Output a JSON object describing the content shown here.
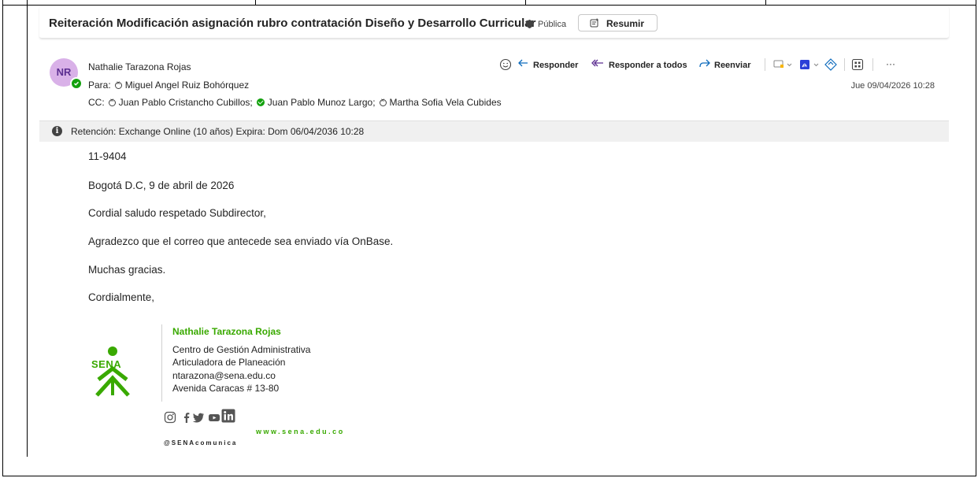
{
  "subject": {
    "title": "Reiteración Modificación asignación rubro contratación Diseño y Desarrollo Curricular",
    "sensitivity_label": "Pública",
    "summarize_label": "Resumir"
  },
  "message": {
    "avatar_initials": "NR",
    "sender": "Nathalie Tarazona Rojas",
    "to_label": "Para:",
    "to": [
      "Miguel Angel Ruiz Bohórquez"
    ],
    "cc_label": "CC:",
    "cc": [
      {
        "name": "Juan Pablo Cristancho Cubillos;",
        "status": "unknown"
      },
      {
        "name": "Juan Pablo Munoz Largo;",
        "status": "available"
      },
      {
        "name": "Martha Sofia Vela Cubides",
        "status": "unknown"
      }
    ],
    "date": "Jue 09/04/2026 10:28"
  },
  "toolbar": {
    "reply": "Responder",
    "reply_all": "Responder a todos",
    "forward": "Reenviar",
    "more": "···"
  },
  "retention": {
    "text": "Retención: Exchange Online (10 años) Expira: Dom 06/04/2036 10:28"
  },
  "body": {
    "lines": [
      "11-9404",
      "Bogotá D.C, 9 de abril de 2026",
      "Cordial saludo respetado Subdirector,",
      "Agradezco que el correo que antecede sea enviado vía OnBase.",
      "Muchas gracias.",
      "Cordialmente,"
    ]
  },
  "signature": {
    "name": "Nathalie Tarazona Rojas",
    "lines": [
      "Centro de Gestión Administrativa",
      "Articuladora de Planeación",
      "ntarazona@sena.edu.co",
      "Avenida Caracas # 13-80"
    ],
    "logo_text": "SENA",
    "website": "www.sena.edu.co",
    "handle": "@SENAcomunica"
  },
  "colors": {
    "sena_green": "#39a900",
    "presence_green": "#13a10e",
    "avatar_bg": "#d9b1e8",
    "accent_blue": "#0f6cbd"
  }
}
